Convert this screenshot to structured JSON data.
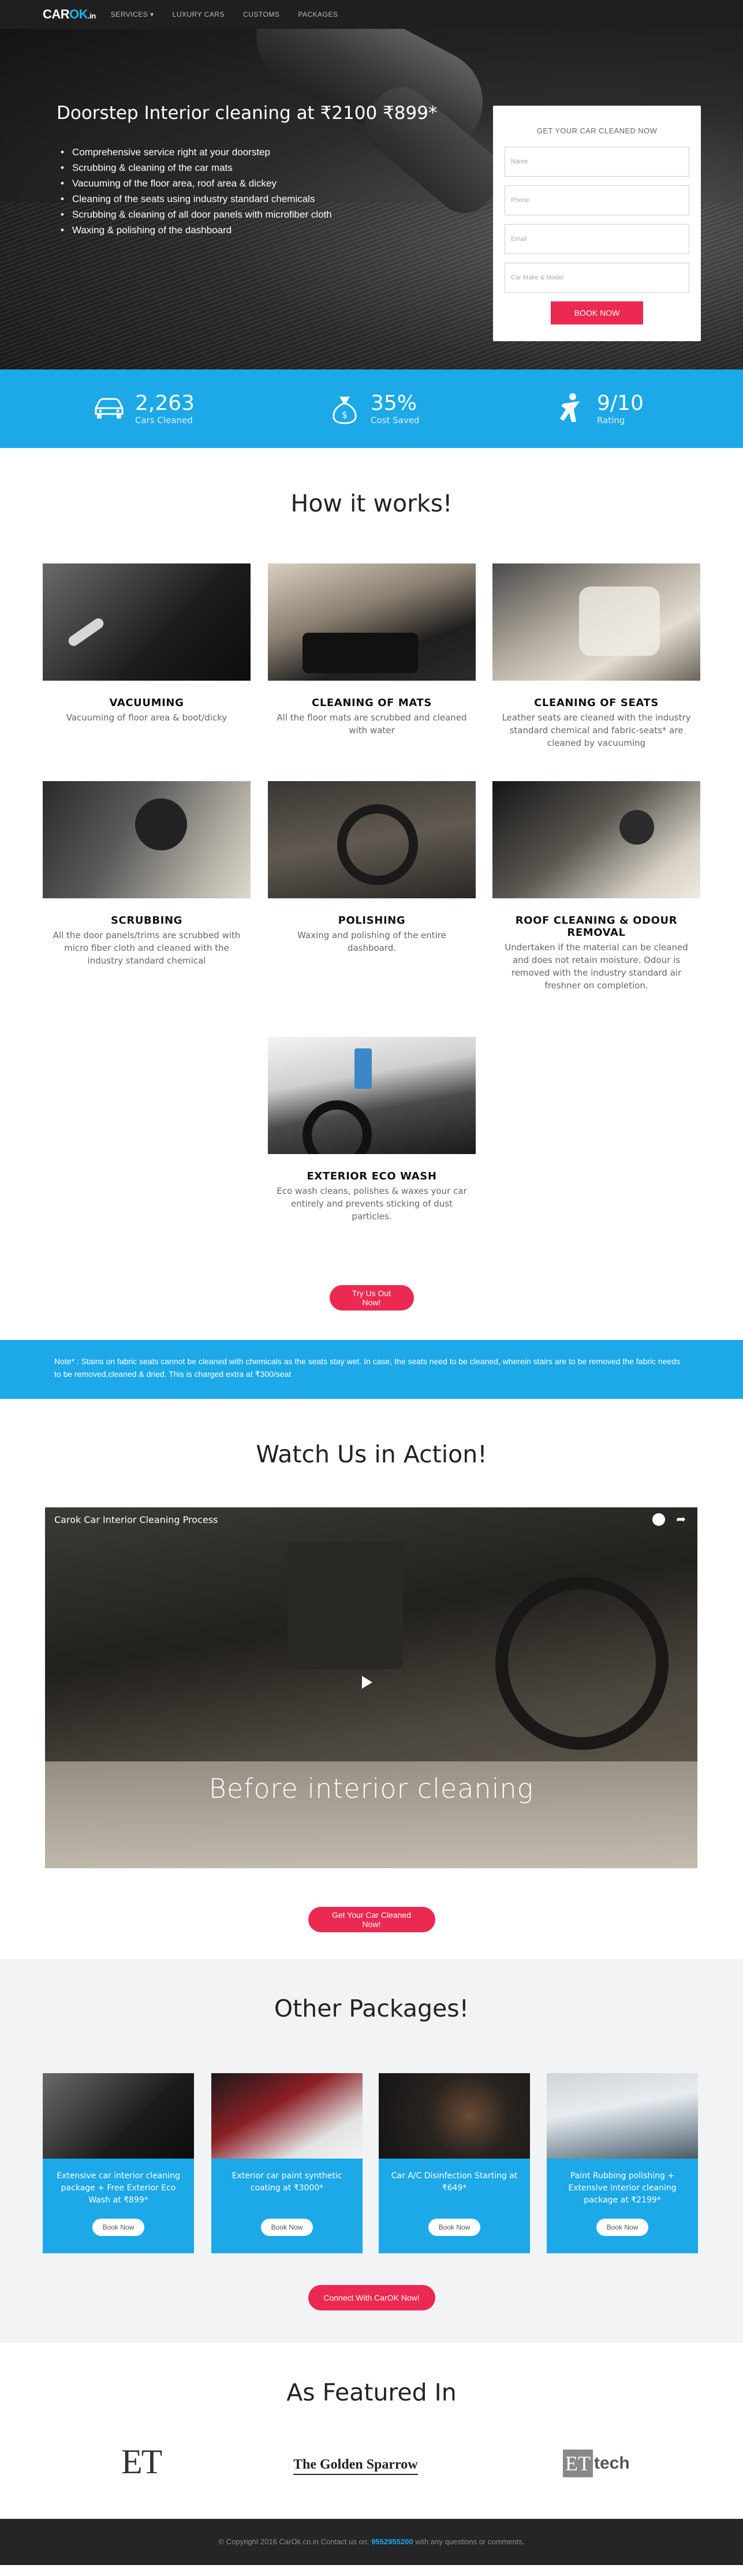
{
  "nav": {
    "logo_main": "CAR",
    "logo_ok": "OK",
    "logo_suffix": ".in",
    "items": [
      "SERVICES ▾",
      "LUXURY CARS",
      "CUSTOMS",
      "PACKAGES"
    ]
  },
  "hero": {
    "title": "Doorstep Interior cleaning at ₹2100 ₹899*",
    "bullets": [
      "Comprehensive service right at your doorstep",
      "Scrubbing & cleaning of the car mats",
      "Vacuuming of the floor area, roof area & dickey",
      "Cleaning of the seats using industry standard chemicals",
      "Scrubbing & cleaning of all door panels with microfiber cloth",
      "Waxing & polishing of the dashboard"
    ]
  },
  "form": {
    "title": "GET YOUR CAR CLEANED NOW",
    "name_placeholder": "Name",
    "phone_placeholder": "Phone",
    "email_placeholder": "Email",
    "car_placeholder": "Car Make & Model",
    "submit": "BOOK NOW"
  },
  "stats": [
    {
      "icon": "car-icon",
      "value": "2,263",
      "label": "Cars Cleaned"
    },
    {
      "icon": "money-bag-icon",
      "value": "35%",
      "label": "Cost Saved"
    },
    {
      "icon": "star-person-icon",
      "value": "9/10",
      "label": "Rating"
    }
  ],
  "how": {
    "title": "How it works!",
    "steps": [
      {
        "title": "VACUUMING",
        "desc": "Vacuuming of floor area & boot/dicky"
      },
      {
        "title": "CLEANING OF MATS",
        "desc": "All the floor mats are scrubbed and cleaned with water"
      },
      {
        "title": "CLEANING OF SEATS",
        "desc": "Leather seats are cleaned with the industry standard chemical and fabric-seats* are cleaned by vacuuming"
      },
      {
        "title": "SCRUBBING",
        "desc": "All the door panels/trims are scrubbed with micro fiber cloth and cleaned with the industry standard chemical"
      },
      {
        "title": "POLISHING",
        "desc": "Waxing and polishing of the entire dashboard."
      },
      {
        "title": "ROOF CLEANING & ODOUR REMOVAL",
        "desc": "Undertaken if the material can be cleaned and does not retain moisture. Odour is removed with the industry standard air freshner on completion."
      },
      {
        "title": "EXTERIOR ECO WASH",
        "desc": "Eco wash cleans, polishes & waxes your car entirely and prevents sticking of dust particles."
      }
    ],
    "cta": "Try Us Out Now!"
  },
  "note": "Note* : Stains on fabric seats cannot be cleaned with chemicals as the seats stay wet. In case, the seats need to be cleaned, wherein stairs are to be removed the fabric needs to be removed,cleaned & dried. This is charged extra at ₹300/seat",
  "watch": {
    "title": "Watch Us in Action!",
    "video_title": "Carok Car Interior Cleaning Process",
    "video_caption": "Before interior cleaning",
    "cta": "Get Your Car Cleaned Now!"
  },
  "packages": {
    "title": "Other Packages!",
    "items": [
      {
        "text": "Extensive car interior cleaning package + Free Exterior Eco Wash at ₹899*",
        "button": "Book Now"
      },
      {
        "text": "Exterior car paint synthetic coating at ₹3000*",
        "button": "Book Now"
      },
      {
        "text": "Car A/C Disinfection Starting at ₹649*",
        "button": "Book Now"
      },
      {
        "text": "Paint Rubbing polishing + Extensive interior cleaning package at ₹2199*",
        "button": "Book Now"
      }
    ],
    "cta": "Connect With CarOK Now!"
  },
  "featured": {
    "title": "As Featured In",
    "logos": [
      "ET",
      "The Golden Sparrow",
      "ET",
      "tech"
    ]
  },
  "footer": {
    "prefix": "© Copyright 2016 CarOk.co.in Contact us on:",
    "phone": "9552955200",
    "suffix": "with any questions or comments."
  },
  "colors": {
    "accent": "#1da8e8",
    "cta": "#ec2950",
    "nav": "#1f1f1f"
  }
}
